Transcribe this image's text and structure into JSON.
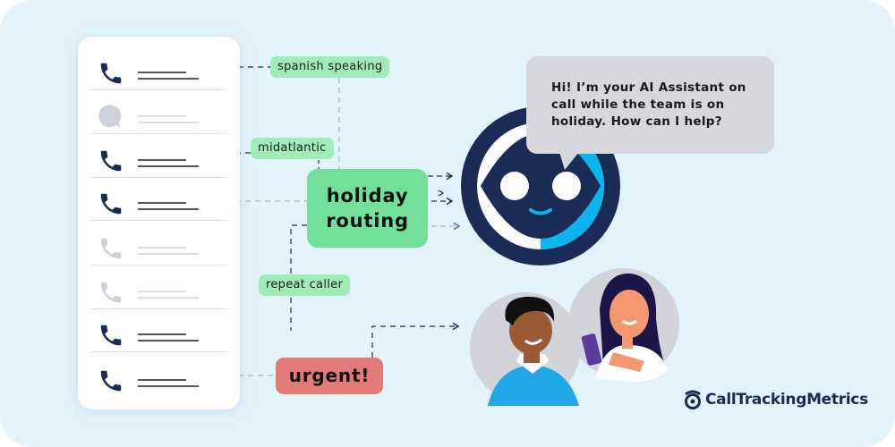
{
  "diagram": {
    "call_list": [
      {
        "icon": "phone-icon",
        "state": "active"
      },
      {
        "icon": "chat-bubble-icon",
        "state": "inactive"
      },
      {
        "icon": "phone-icon",
        "state": "active"
      },
      {
        "icon": "phone-icon",
        "state": "active"
      },
      {
        "icon": "phone-icon",
        "state": "inactive"
      },
      {
        "icon": "phone-icon",
        "state": "inactive"
      },
      {
        "icon": "phone-icon",
        "state": "active"
      },
      {
        "icon": "phone-icon",
        "state": "active"
      }
    ],
    "tags": {
      "spanish": "spanish speaking",
      "midatlantic": "midatlantic",
      "repeat": "repeat caller"
    },
    "main_node": {
      "line1": "holiday",
      "line2": "routing"
    },
    "urgent": "urgent!",
    "assistant_message": "Hi! I’m your AI Assistant on call while the team is on holiday. How can I help?",
    "brand": "CallTrackingMetrics"
  },
  "colors": {
    "background": "#e3f3fb",
    "tag_green": "#a0ecb8",
    "main_green": "#72e09a",
    "urgent_red": "#e27a78",
    "navy": "#1a2c55",
    "robot_blue": "#0bb4ef",
    "bubble_gray": "#d7d8db"
  }
}
